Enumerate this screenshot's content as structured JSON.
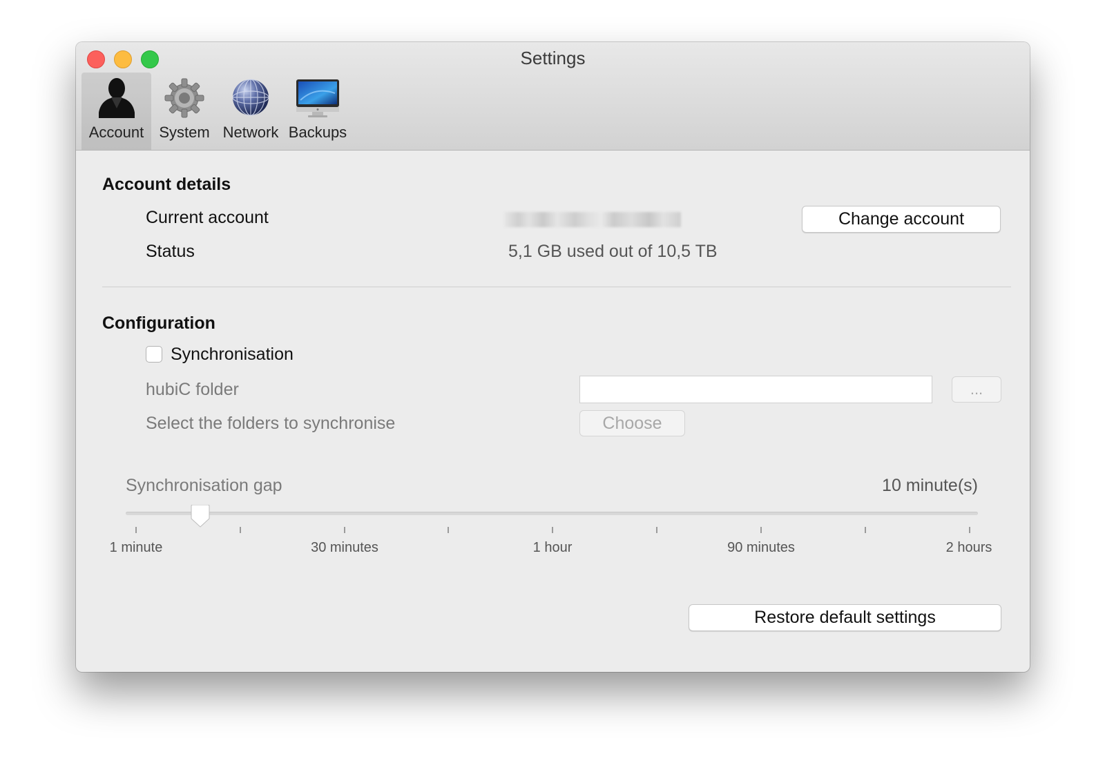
{
  "window": {
    "title": "Settings"
  },
  "toolbar": {
    "tabs": [
      {
        "label": "Account",
        "icon": "account-icon",
        "selected": true
      },
      {
        "label": "System",
        "icon": "gear-icon",
        "selected": false
      },
      {
        "label": "Network",
        "icon": "globe-icon",
        "selected": false
      },
      {
        "label": "Backups",
        "icon": "monitor-icon",
        "selected": false
      }
    ]
  },
  "account": {
    "section_title": "Account details",
    "current_account_label": "Current account",
    "current_account_value": "",
    "change_account_label": "Change account",
    "status_label": "Status",
    "status_value": "5,1 GB used out of 10,5 TB"
  },
  "configuration": {
    "section_title": "Configuration",
    "sync_label": "Synchronisation",
    "sync_checked": false,
    "folder_label": "hubiC folder",
    "folder_value": "",
    "browse_label": "...",
    "select_folders_label": "Select the folders to synchronise",
    "choose_label": "Choose",
    "gap_label": "Synchronisation gap",
    "gap_value": "10 minute(s)",
    "slider": {
      "min": 1,
      "max": 120,
      "value": 10,
      "tick_labels": [
        "1 minute",
        "30 minutes",
        "1 hour",
        "90 minutes",
        "2 hours"
      ]
    }
  },
  "footer": {
    "restore_label": "Restore default settings"
  },
  "colors": {
    "close": "#fc605c",
    "minimize": "#fdbc40",
    "maximize": "#34c84a",
    "window_bg": "#ececec",
    "accent_selected_tab": "rgba(0,0,0,0.09)"
  }
}
